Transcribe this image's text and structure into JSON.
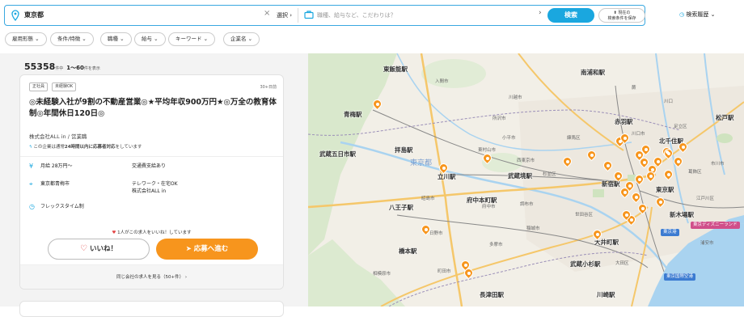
{
  "search": {
    "location": "東京都",
    "select_label": "選択",
    "keyword_placeholder": "職種、給与など、こだわりは？",
    "search_button": "検索",
    "save_line1": "現在の",
    "save_line2": "検索条件を保存",
    "history_label": "検索履歴"
  },
  "filters": [
    "雇用形態",
    "条件/特徴",
    "職種",
    "給与",
    "キーワード",
    "企業名"
  ],
  "results": {
    "count": "55358",
    "count_unit": "件中",
    "range": "1〜60",
    "range_unit": "件を表示"
  },
  "job": {
    "tags": [
      "正社員",
      "未経験OK"
    ],
    "posted": "30+日前",
    "title": "◎未経験入社が9割の不動産営業◎★平均年収900万円★◎万全の教育体制◎年間休日120日◎",
    "company": "株式会社ALL in / 営業職",
    "response_prefix": "この企業は通常",
    "response_bold": "24時間以内に応募者対応",
    "response_suffix": "をしています",
    "salary": "月給 28万円〜",
    "transport": "交通費支給あり",
    "location": "東京都青梅市",
    "remote": "テレワーク・在宅OK",
    "company_short": "株式会社ALL in",
    "shift": "フレックスタイム制",
    "likes_text": "1人がこの求人をいいね！しています",
    "like_button": "いいね！",
    "apply_button": "応募へ進む",
    "same_company": "同じ会社の求人を見る（50+件）"
  },
  "map": {
    "stations": [
      "東飯能駅",
      "南浦和駅",
      "青梅駅",
      "赤羽駅",
      "北千住駅",
      "松戸駅",
      "拝島駅",
      "武蔵五日市駅",
      "立川駅",
      "武蔵境駅",
      "新宿駅",
      "府中本町駅",
      "八王子駅",
      "新木場駅",
      "橋本駅",
      "大井町駅",
      "武蔵小杉駅",
      "長津田駅",
      "川崎駅",
      "東京駅"
    ],
    "areas": [
      "入間市",
      "所沢市",
      "川口市",
      "東村山市",
      "昭島市",
      "日野市",
      "多摩市",
      "町田市",
      "稲城市",
      "相模原市",
      "西東京市",
      "世田谷区",
      "杉並区",
      "市川市",
      "江戸川区",
      "大田区",
      "川越市",
      "川口",
      "蕨",
      "練馬区",
      "小平市",
      "府中市",
      "調布市",
      "足立区",
      "葛飾区",
      "浦安市"
    ],
    "prefecture_label": "東京都",
    "poi_disney": "東京ディズニーランド",
    "poi_airport": "東京国際空港",
    "poi_tokyo": "東京港"
  },
  "colors": {
    "accent": "#1aa7df",
    "apply": "#f7951d",
    "pin": "#f7951d"
  }
}
